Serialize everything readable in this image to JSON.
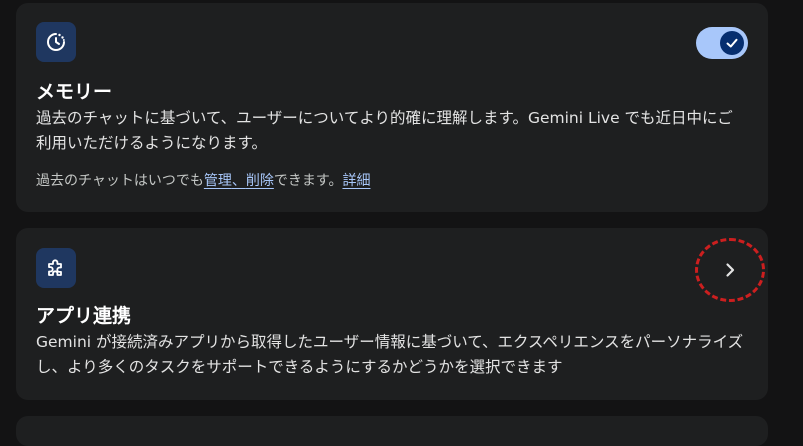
{
  "memory": {
    "icon": "memory-icon",
    "title": "メモリー",
    "description": "過去のチャットに基づいて、ユーザーについてより的確に理解します。Gemini Live でも近日中にご利用いただけるようになります。",
    "footnote_prefix": "過去のチャットはいつでも",
    "manage_link": "管理",
    "separator": "、",
    "delete_link": "削除",
    "footnote_suffix": "できます。",
    "details_link": "詳細",
    "toggle_on": true
  },
  "apps": {
    "icon": "puzzle-icon",
    "title": "アプリ連携",
    "description": "Gemini が接続済みアプリから取得したユーザー情報に基づいて、エクスペリエンスをパーソナライズし、より多くのタスクをサポートできるようにするかどうかを選択できます",
    "chevron": "chevron-right-icon"
  },
  "colors": {
    "accent": "#a8c7fa",
    "annotation": "#cc1f1f"
  }
}
